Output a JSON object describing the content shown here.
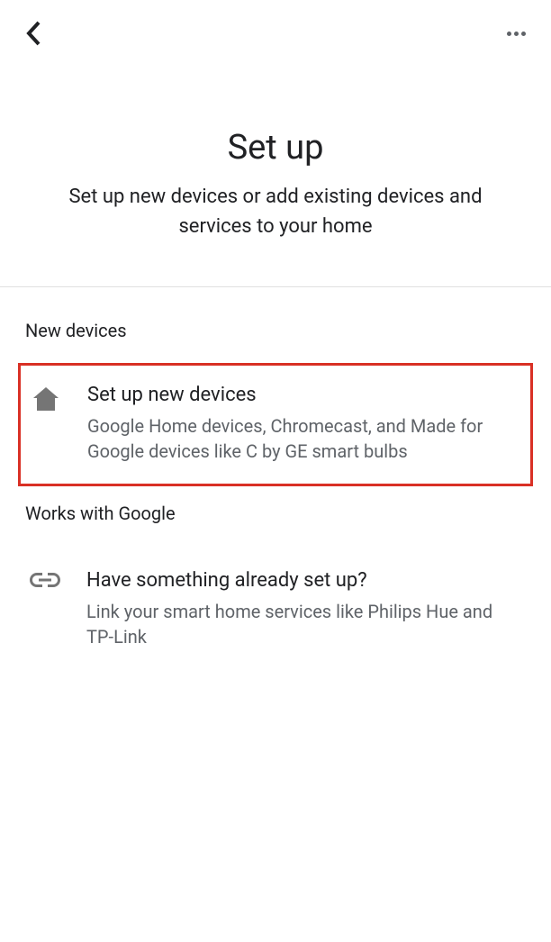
{
  "header": {
    "title": "Set up",
    "subtitle": "Set up new devices or add existing devices and services to your home"
  },
  "sections": {
    "new_devices": {
      "label": "New devices",
      "option": {
        "title": "Set up new devices",
        "description": "Google Home devices, Chromecast, and Made for Google devices like C by GE smart bulbs"
      }
    },
    "works_with_google": {
      "label": "Works with Google",
      "option": {
        "title": "Have something already set up?",
        "description": "Link your smart home services like Philips Hue and TP-Link"
      }
    }
  }
}
